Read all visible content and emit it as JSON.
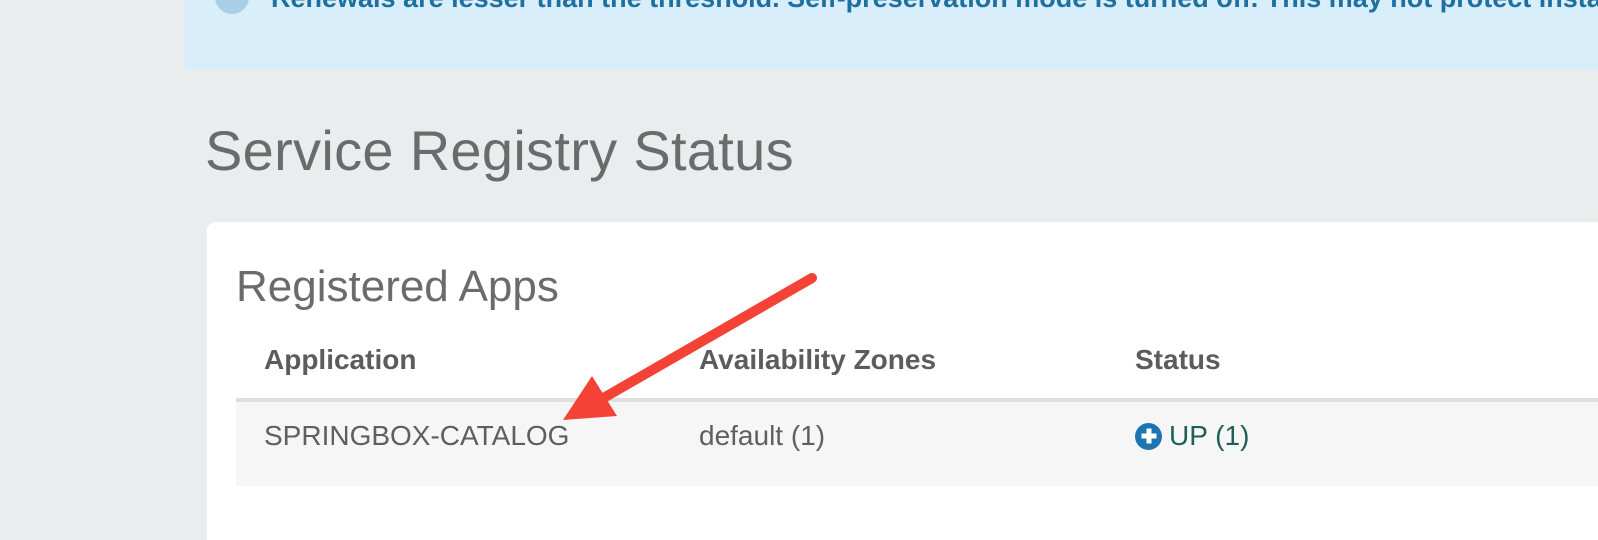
{
  "alert": {
    "text": "Renewals are lesser than the threshold. Self-preservation mode is turned off. This may not protect instance expiry in case of network/other problems."
  },
  "page": {
    "title": "Service Registry Status"
  },
  "registered_apps": {
    "title": "Registered Apps",
    "columns": {
      "application": "Application",
      "zones": "Availability Zones",
      "status": "Status"
    },
    "rows": [
      {
        "application": "SPRINGBOX-CATALOG",
        "zones": "default (1)",
        "status": "UP (1)",
        "status_icon": "plus-circle-icon"
      }
    ]
  },
  "annotation": {
    "arrow_color": "#f44336",
    "icon": "red-arrow-icon"
  },
  "colors": {
    "alert_bg": "#d8eefb",
    "status_icon": "#1f75b1",
    "status_text": "#1e5f56"
  }
}
